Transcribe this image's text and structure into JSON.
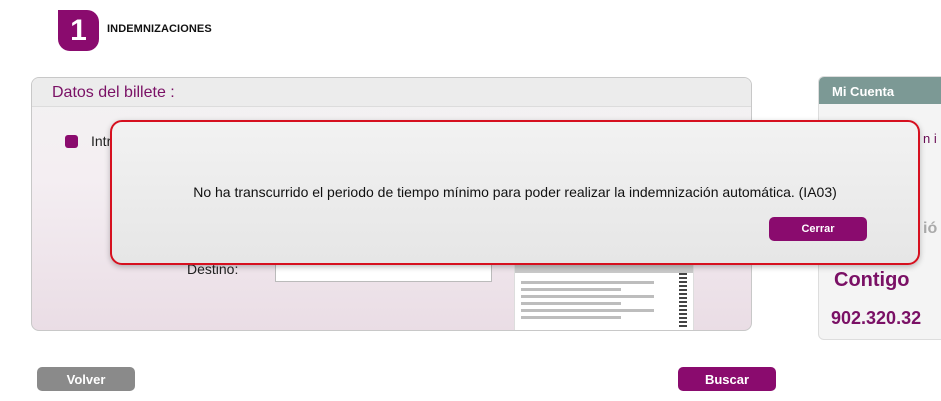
{
  "step": {
    "number": "1",
    "title": "INDEMNIZACIONES"
  },
  "panel": {
    "title": "Datos del billete :",
    "checkbox_label": "Intr",
    "destino_label": "Destino:",
    "destino_value": ""
  },
  "side": {
    "header": "Mi Cuenta",
    "fragment": "n i",
    "fragment2": "ió",
    "contigo": "Contigo",
    "phone": "902.320.32"
  },
  "buttons": {
    "volver": "Volver",
    "buscar": "Buscar"
  },
  "modal": {
    "message": "No ha transcurrido el periodo de tiempo mínimo para poder realizar la indemnización automática. (IA03)",
    "close_label": "Cerrar"
  },
  "colors": {
    "brand": "#8a0b6e",
    "alert_border": "#d6101f",
    "side_header": "#7c9995"
  }
}
